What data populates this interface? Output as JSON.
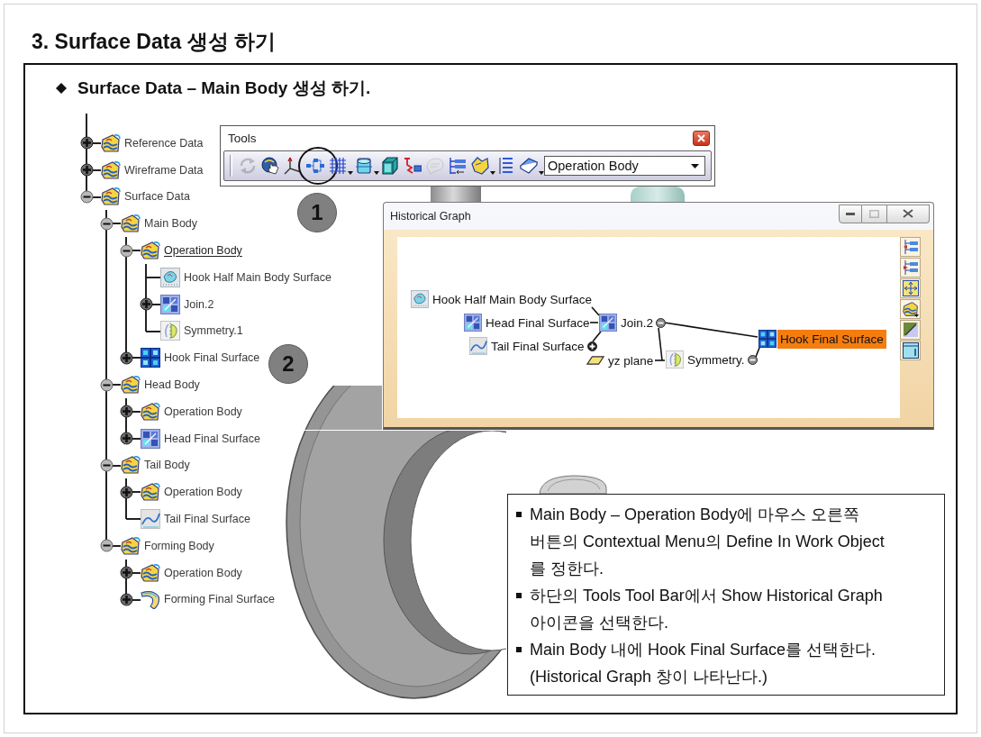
{
  "title": "3. Surface Data 생성 하기",
  "section": {
    "heading": "Surface Data – Main Body 생성 하기."
  },
  "tree": {
    "items": [
      {
        "label": "Reference Data",
        "kind": "set",
        "expandable": true,
        "expanded": false,
        "in_work": false
      },
      {
        "label": "Wireframe Data",
        "kind": "set",
        "expandable": true,
        "expanded": false,
        "in_work": false
      },
      {
        "label": "Surface Data",
        "kind": "set",
        "expandable": true,
        "expanded": true,
        "in_work": false,
        "children": [
          {
            "label": "Main Body",
            "kind": "set",
            "expandable": true,
            "expanded": true,
            "in_work": false,
            "children": [
              {
                "label": "Operation Body",
                "kind": "set",
                "expandable": true,
                "expanded": true,
                "in_work": true,
                "children": [
                  {
                    "label": "Hook Half Main Body Surface",
                    "kind": "extract",
                    "expandable": false,
                    "in_work": false
                  },
                  {
                    "label": "Join.2",
                    "kind": "join",
                    "expandable": true,
                    "expanded": false,
                    "in_work": false
                  },
                  {
                    "label": "Symmetry.1",
                    "kind": "symmetry",
                    "expandable": false,
                    "in_work": false
                  }
                ]
              },
              {
                "label": "Hook Final Surface",
                "kind": "grid",
                "expandable": true,
                "expanded": false,
                "in_work": false
              }
            ]
          },
          {
            "label": "Head Body",
            "kind": "set",
            "expandable": true,
            "expanded": true,
            "in_work": false,
            "children": [
              {
                "label": "Operation Body",
                "kind": "set",
                "expandable": true,
                "expanded": false,
                "in_work": false
              },
              {
                "label": "Head Final Surface",
                "kind": "join",
                "expandable": true,
                "expanded": false,
                "in_work": false
              }
            ]
          },
          {
            "label": "Tail Body",
            "kind": "set",
            "expandable": true,
            "expanded": true,
            "in_work": false,
            "children": [
              {
                "label": "Operation Body",
                "kind": "set",
                "expandable": true,
                "expanded": false,
                "in_work": false
              },
              {
                "label": "Tail Final Surface",
                "kind": "blend",
                "expandable": false,
                "in_work": false
              }
            ]
          },
          {
            "label": "Forming Body",
            "kind": "set",
            "expandable": true,
            "expanded": true,
            "in_work": false,
            "children": [
              {
                "label": "Operation Body",
                "kind": "set",
                "expandable": true,
                "expanded": false,
                "in_work": false
              },
              {
                "label": "Forming Final Surface",
                "kind": "sweep",
                "expandable": true,
                "expanded": false,
                "in_work": false
              }
            ]
          }
        ]
      }
    ]
  },
  "tools_toolbar": {
    "title": "Tools",
    "buttons": [
      {
        "kind": "update",
        "disabled": true,
        "menu": false,
        "circled": false
      },
      {
        "kind": "hand",
        "disabled": false,
        "menu": false,
        "circled": false
      },
      {
        "kind": "axis",
        "disabled": false,
        "menu": false,
        "circled": false
      },
      {
        "kind": "graph",
        "disabled": false,
        "menu": false,
        "circled": true
      },
      {
        "kind": "grid",
        "disabled": false,
        "menu": true,
        "circled": false
      },
      {
        "kind": "box",
        "disabled": false,
        "menu": true,
        "circled": false
      },
      {
        "kind": "cube",
        "disabled": false,
        "menu": false,
        "circled": false
      },
      {
        "kind": "link",
        "disabled": false,
        "menu": false,
        "circled": false
      },
      {
        "kind": "scan",
        "disabled": true,
        "menu": false,
        "circled": false
      },
      {
        "kind": "tree",
        "disabled": false,
        "menu": false,
        "circled": false
      },
      {
        "kind": "shape",
        "disabled": false,
        "menu": true,
        "circled": false
      },
      {
        "kind": "stack",
        "disabled": false,
        "menu": false,
        "circled": false
      },
      {
        "kind": "book",
        "disabled": false,
        "menu": true,
        "circled": false
      }
    ],
    "dropdown": {
      "value": "Operation Body"
    }
  },
  "callouts": [
    "1",
    "2"
  ],
  "historical_graph": {
    "title": "Historical Graph",
    "maximize_disabled": true,
    "nodes": [
      {
        "label": "Hook Half Main Body Surface",
        "kind": "extract",
        "expandable": false,
        "selected": false
      },
      {
        "label": "Head Final Surface",
        "kind": "join",
        "expandable": false,
        "selected": false
      },
      {
        "label": "Tail Final Surface",
        "kind": "blend",
        "expandable": true,
        "expanded": false,
        "selected": false
      },
      {
        "label": "Join.2",
        "kind": "join",
        "expandable": true,
        "expanded": true,
        "selected": false
      },
      {
        "label": "yz plane",
        "kind": "plane",
        "expandable": false,
        "selected": false
      },
      {
        "label": "Symmetry.",
        "kind": "symmetry",
        "expandable": true,
        "expanded": true,
        "selected": false
      },
      {
        "label": "Hook Final Surface",
        "kind": "grid",
        "expandable": false,
        "selected": true
      }
    ]
  },
  "instructions": [
    "Main Body – Operation Body에 마우스 오른쪽\n버튼의 Contextual Menu의 Define In Work Object\n를 정한다.",
    "하단의 Tools Tool Bar에서 Show Historical Graph\n아이콘을 선택한다.",
    "Main Body 내에 Hook Final Surface를 선택한다.\n(Historical Graph 창이 나타난다.)"
  ]
}
